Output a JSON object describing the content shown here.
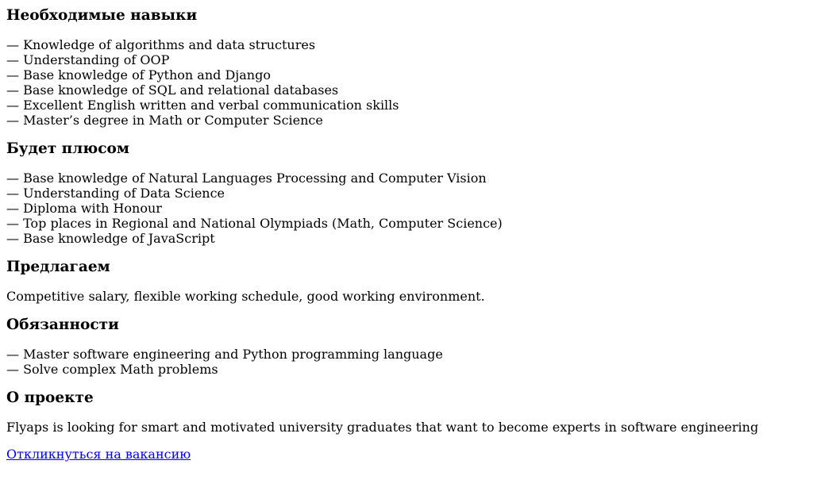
{
  "sections": {
    "skills": {
      "title": "Необходимые навыки",
      "items": [
        "— Knowledge of algorithms and data structures",
        "— Understanding of OOP",
        "— Base knowledge of Python and Django",
        "— Base knowledge of SQL and relational databases",
        "— Excellent English written and verbal communication skills",
        "— Master’s degree in Math or Computer Science"
      ]
    },
    "plus": {
      "title": "Будет плюсом",
      "items": [
        "— Base knowledge of Natural Languages Processing and Computer Vision",
        "— Understanding of Data Science",
        "— Diploma with Honour",
        "— Top places in Regional and National Olympiads (Math, Computer Science)",
        "— Base knowledge of JavaScript"
      ]
    },
    "offer": {
      "title": "Предлагаем",
      "text": "Competitive salary, flexible working schedule, good working environment."
    },
    "duties": {
      "title": "Обязанности",
      "items": [
        "— Master software engineering and Python programming language",
        "— Solve complex Math problems"
      ]
    },
    "about": {
      "title": "О проекте",
      "text": "Flyaps is looking for smart and motivated university graduates that want to become experts in software engineering"
    }
  },
  "apply_link": "Откликнуться на вакансию",
  "colors": {
    "text": "#000000",
    "link": "#0000ee",
    "background": "#ffffff"
  }
}
